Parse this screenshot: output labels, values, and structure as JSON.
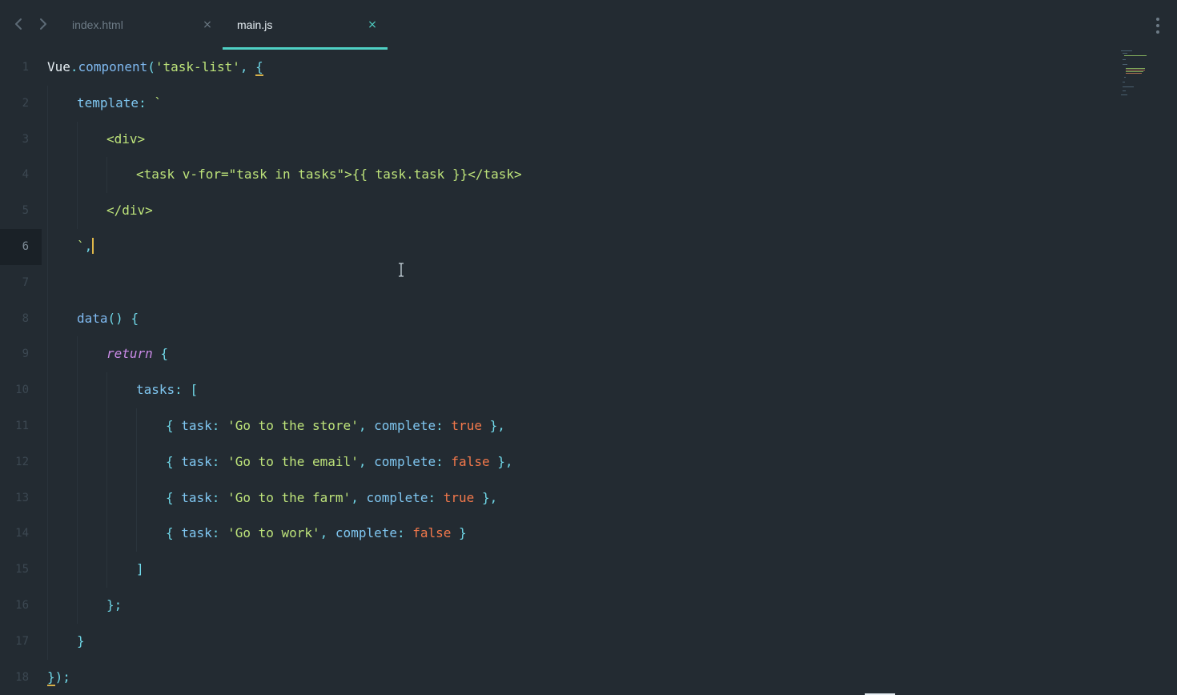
{
  "tabs": [
    {
      "label": "index.html",
      "close": "×",
      "active": false
    },
    {
      "label": "main.js",
      "close": "×",
      "active": true
    }
  ],
  "nav": {
    "back_icon": "chevron-left-icon",
    "forward_icon": "chevron-right-icon",
    "menu_icon": "kebab-menu-icon"
  },
  "editor": {
    "current_line": 6,
    "lines": [
      {
        "num": "1"
      },
      {
        "num": "2"
      },
      {
        "num": "3"
      },
      {
        "num": "4"
      },
      {
        "num": "5"
      },
      {
        "num": "6"
      },
      {
        "num": "7"
      },
      {
        "num": "8"
      },
      {
        "num": "9"
      },
      {
        "num": "10"
      },
      {
        "num": "11"
      },
      {
        "num": "12"
      },
      {
        "num": "13"
      },
      {
        "num": "14"
      },
      {
        "num": "15"
      },
      {
        "num": "16"
      },
      {
        "num": "17"
      },
      {
        "num": "18"
      }
    ],
    "code": {
      "l1": {
        "obj": "Vue",
        "dot": ".",
        "fn": "component",
        "open": "(",
        "str": "'task-list'",
        "comma": ", ",
        "brace": "{"
      },
      "l2": {
        "key": "template",
        "colon": ": ",
        "tick": "`"
      },
      "l3": {
        "text": "<div>"
      },
      "l4": {
        "text": "<task v-for=\"task in tasks\">{{ task.task }}</task>"
      },
      "l5": {
        "text": "</div>"
      },
      "l6": {
        "tick": "`",
        "comma": ","
      },
      "l8": {
        "fn": "data",
        "parens": "() ",
        "brace": "{"
      },
      "l9": {
        "kw": "return",
        "brace": " {"
      },
      "l10": {
        "key": "tasks",
        "colon": ": ",
        "bracket": "["
      },
      "l11": {
        "open": "{ ",
        "k1": "task",
        "c1": ": ",
        "v1": "'Go to the store'",
        "sep": ", ",
        "k2": "complete",
        "c2": ": ",
        "v2": "true",
        "close": " },"
      },
      "l12": {
        "open": "{ ",
        "k1": "task",
        "c1": ": ",
        "v1": "'Go to the email'",
        "sep": ", ",
        "k2": "complete",
        "c2": ": ",
        "v2": "false",
        "close": " },"
      },
      "l13": {
        "open": "{ ",
        "k1": "task",
        "c1": ": ",
        "v1": "'Go to the farm'",
        "sep": ", ",
        "k2": "complete",
        "c2": ": ",
        "v2": "true",
        "close": " },"
      },
      "l14": {
        "open": "{ ",
        "k1": "task",
        "c1": ": ",
        "v1": "'Go to work'",
        "sep": ", ",
        "k2": "complete",
        "c2": ": ",
        "v2": "false",
        "close": " }"
      },
      "l15": {
        "text": "]"
      },
      "l16": {
        "text": "};"
      },
      "l17": {
        "text": "}"
      },
      "l18": {
        "brace": "}",
        "rest": ");"
      }
    }
  },
  "colors": {
    "background": "#232b32",
    "accent": "#4fd0c4",
    "string": "#bde37a",
    "boolean": "#f2784b",
    "keyword": "#c98ae6",
    "function": "#7fb9f0",
    "caret": "#e0b84a"
  }
}
